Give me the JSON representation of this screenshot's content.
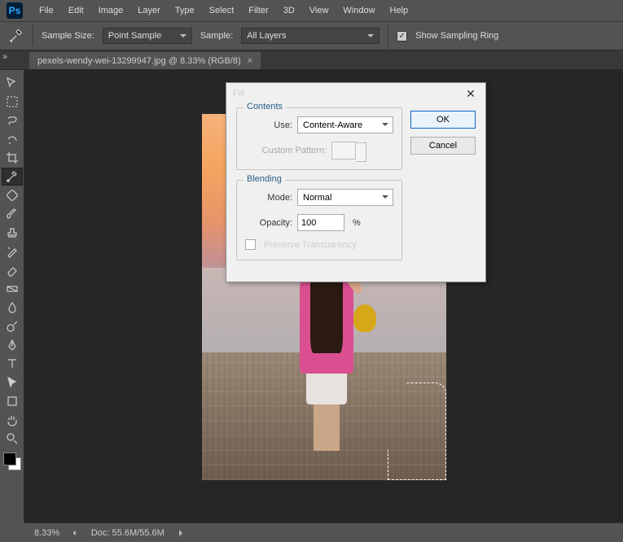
{
  "menubar": {
    "items": [
      "File",
      "Edit",
      "Image",
      "Layer",
      "Type",
      "Select",
      "Filter",
      "3D",
      "View",
      "Window",
      "Help"
    ]
  },
  "optbar": {
    "sample_size_label": "Sample Size:",
    "sample_size_value": "Point Sample",
    "sample_label": "Sample:",
    "sample_value": "All Layers",
    "show_ring_label": "Show Sampling Ring"
  },
  "tab": {
    "title": "pexels-wendy-wei-13299947.jpg @ 8.33% (RGB/8)"
  },
  "status": {
    "zoom": "8.33%",
    "doc_label": "Doc:",
    "doc_value": "55.6M/55.6M"
  },
  "dialog": {
    "title": "Fill",
    "contents_legend": "Contents",
    "use_label": "Use:",
    "use_value": "Content-Aware",
    "pattern_label": "Custom Pattern:",
    "blending_legend": "Blending",
    "mode_label": "Mode:",
    "mode_value": "Normal",
    "opacity_label": "Opacity:",
    "opacity_value": "100",
    "pct": "%",
    "preserve_label": "Preserve Transparency",
    "ok": "OK",
    "cancel": "Cancel"
  }
}
